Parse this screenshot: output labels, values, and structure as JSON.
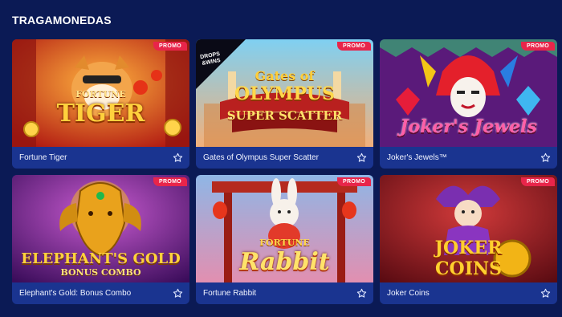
{
  "section": {
    "title": "TRAGAMONEDAS"
  },
  "games": [
    {
      "name": "Fortune Tiger",
      "badge": "PROMO",
      "art": "tiger-art",
      "logo": [
        "FORTUNE",
        "TIGER"
      ]
    },
    {
      "name": "Gates of Olympus Super Scatter",
      "badge": "PROMO",
      "art": "olympus-art",
      "logo": [
        "Gates of",
        "OLYMPUS",
        "SUPER SCATTER"
      ],
      "corner": [
        "DROPS",
        "&WINS"
      ]
    },
    {
      "name": "Joker's Jewels™",
      "badge": "PROMO",
      "art": "jewels-art",
      "logo": [
        "Joker's Jewels"
      ]
    },
    {
      "name": "Elephant's Gold: Bonus Combo",
      "badge": "PROMO",
      "art": "elephant-art",
      "logo": [
        "ELEPHANT'S GOLD",
        "BONUS COMBO"
      ]
    },
    {
      "name": "Fortune Rabbit",
      "badge": "PROMO",
      "art": "rabbit-art",
      "logo": [
        "FORTUNE",
        "Rabbit"
      ]
    },
    {
      "name": "Joker Coins",
      "badge": "PROMO",
      "art": "coins-art",
      "logo": [
        "JOKER",
        "COINS"
      ]
    }
  ],
  "colors": {
    "page_bg": "#0b1a55",
    "card_bg": "#1a3490",
    "badge": "#e8254a"
  },
  "icons": {
    "favorite": "star-outline-icon"
  }
}
